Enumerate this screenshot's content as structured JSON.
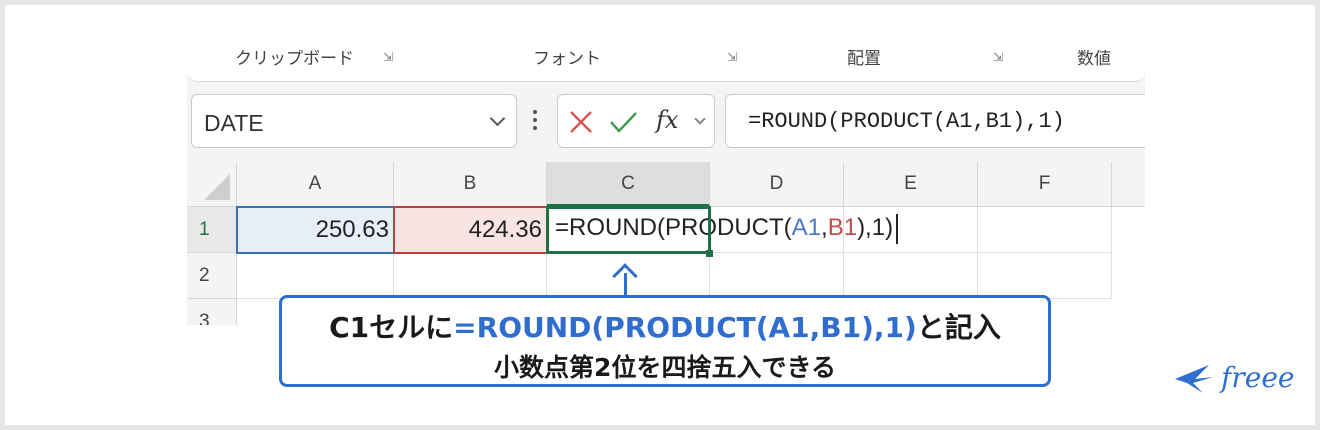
{
  "ribbon": {
    "groups": [
      "クリップボード",
      "フォント",
      "配置",
      "数値"
    ]
  },
  "namebox": {
    "value": "DATE"
  },
  "formula_bar": {
    "value": "=ROUND(PRODUCT(A1,B1),1)"
  },
  "columns": [
    "A",
    "B",
    "C",
    "D",
    "E",
    "F"
  ],
  "rows": [
    "1",
    "2",
    "3"
  ],
  "cells": {
    "A1": "250.63",
    "B1": "424.36",
    "C1_prefix": "=ROUND(PRODUCT(",
    "C1_ref_a": "A1",
    "C1_comma": ",",
    "C1_ref_b": "B1",
    "C1_suffix": "),1)"
  },
  "callout": {
    "line1_prefix": "C1セルに",
    "line1_formula": "=ROUND(PRODUCT(A1,B1),1)",
    "line1_suffix": "と記入",
    "line2": "小数点第2位を四捨五入できる"
  },
  "logo": {
    "text": "freee"
  },
  "colors": {
    "accent": "#2f6dcf",
    "excel_green": "#1e7145",
    "ref_a": "#4a7bc0",
    "ref_b": "#c24d4d"
  }
}
